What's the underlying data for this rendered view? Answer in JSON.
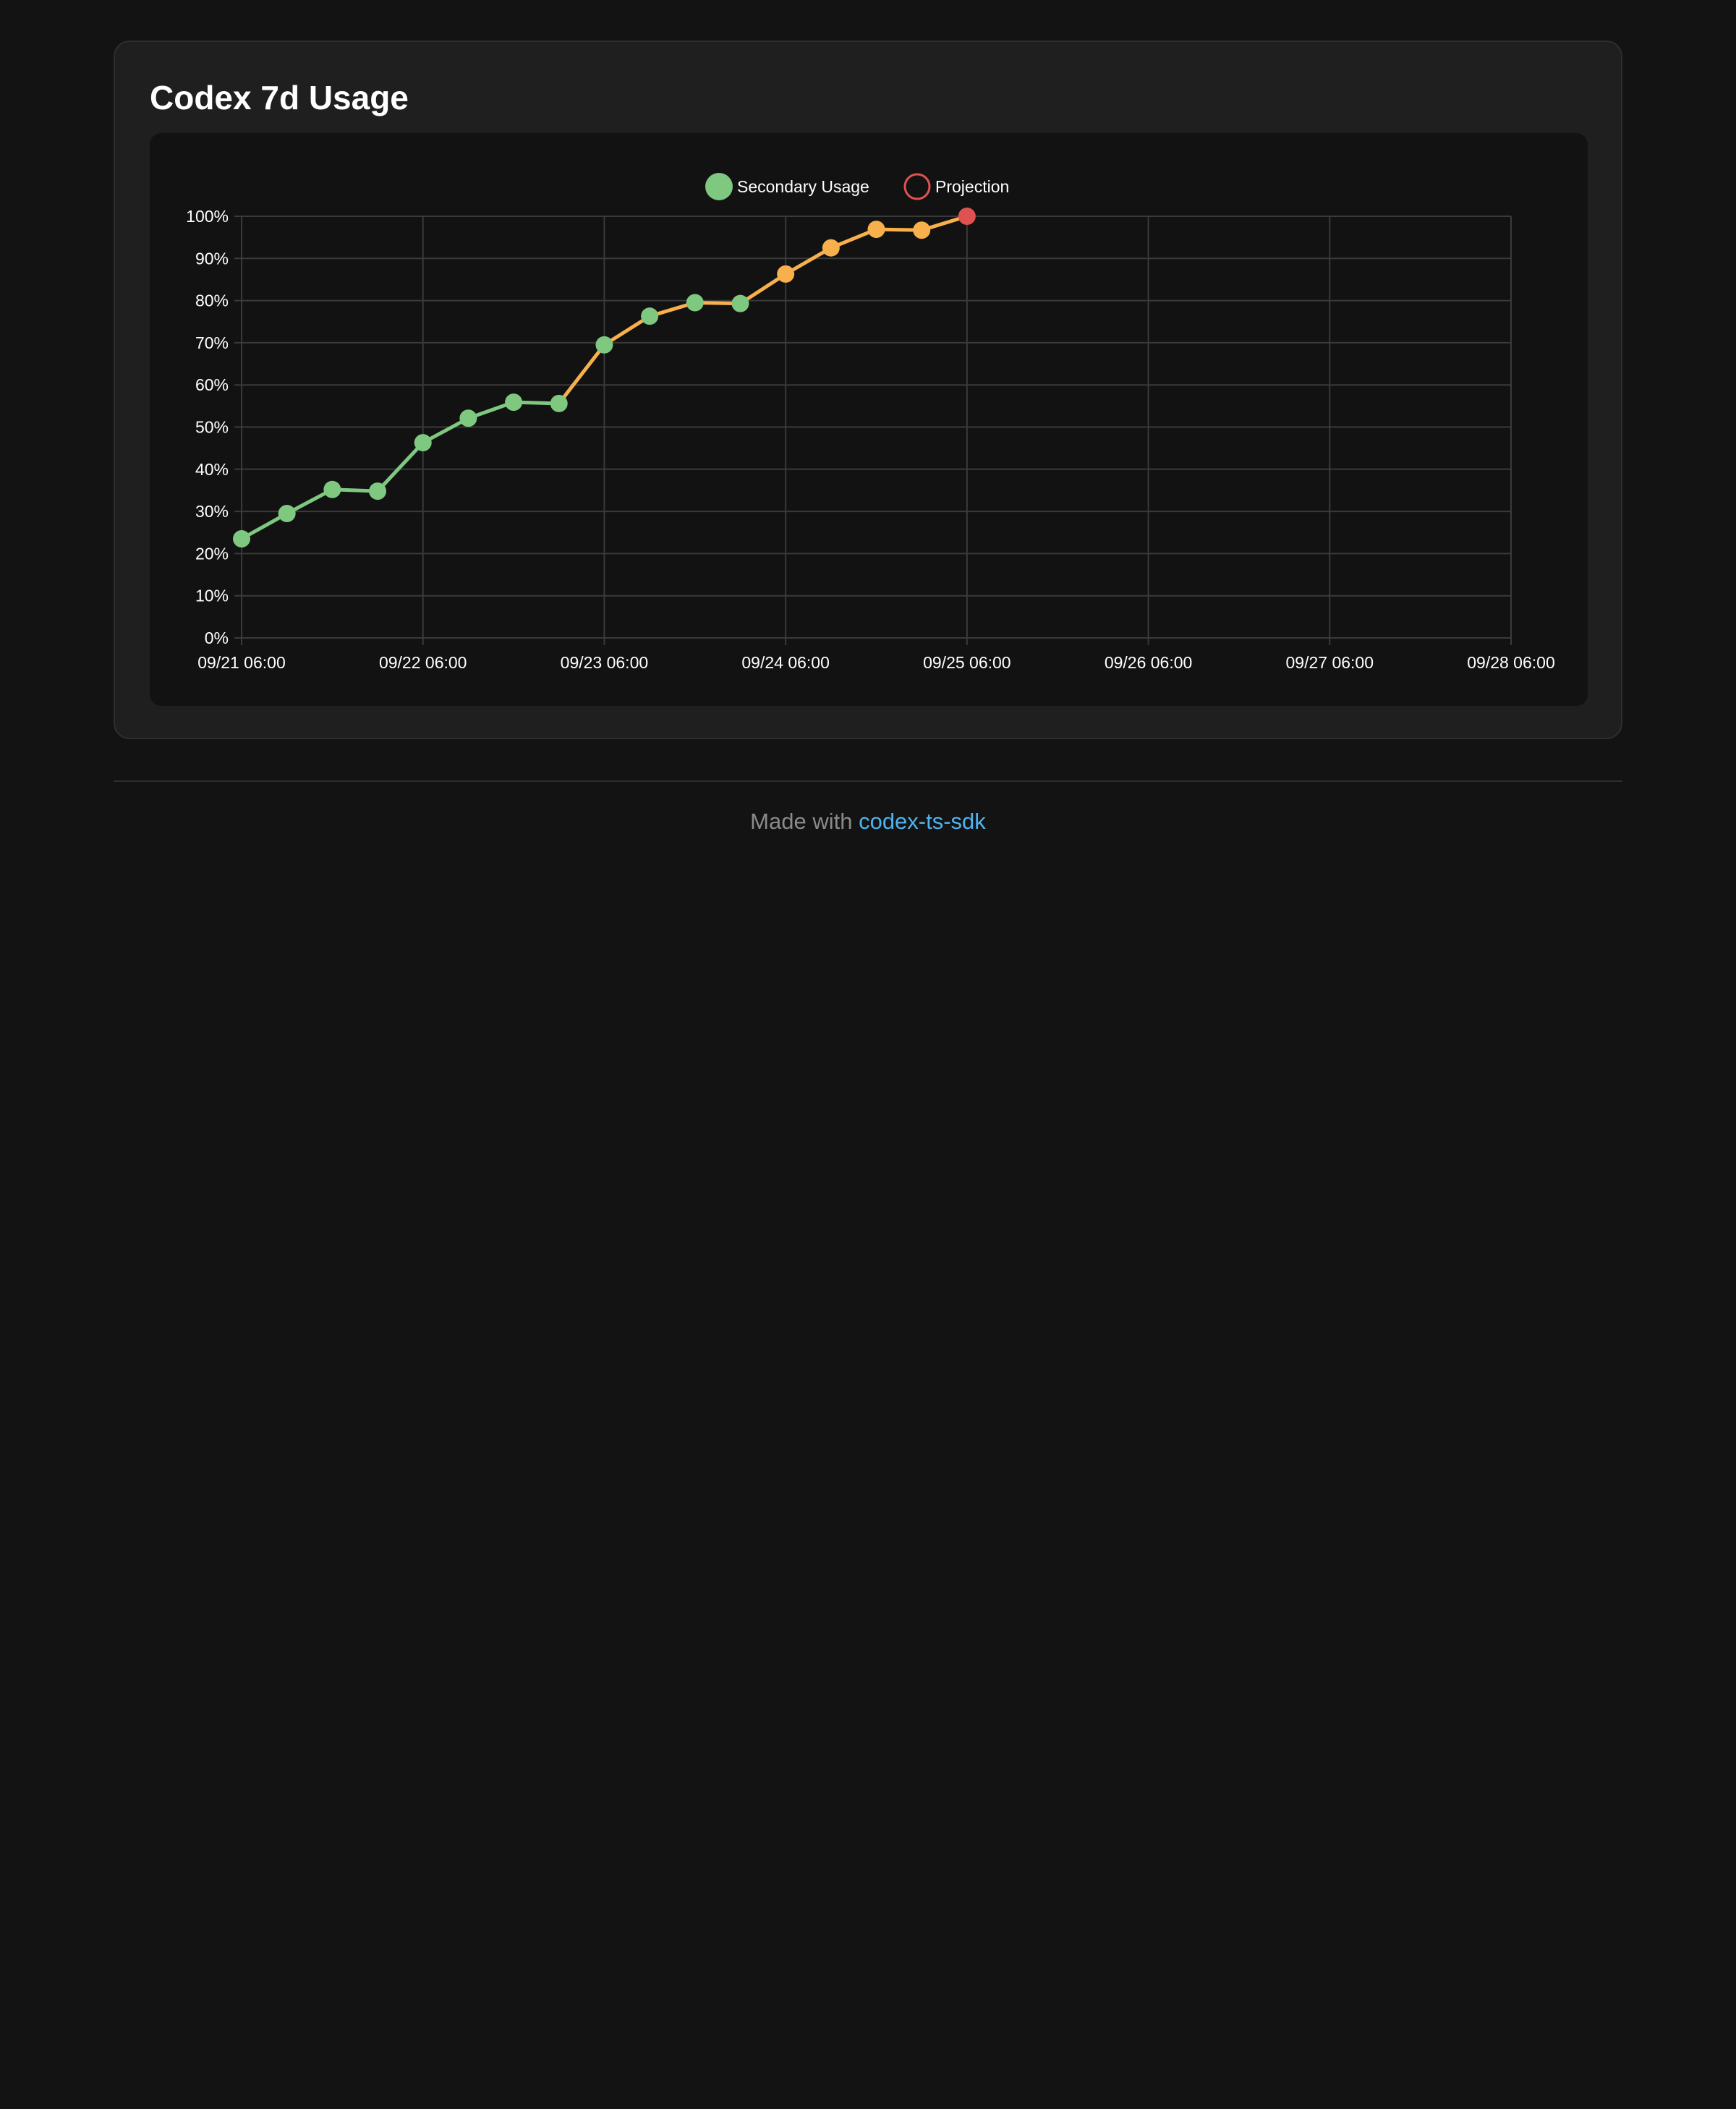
{
  "card": {
    "title": "Codex 7d Usage"
  },
  "chart_data": {
    "type": "line",
    "title": "",
    "xlabel": "",
    "ylabel": "",
    "x_range": [
      "09/21 06:00",
      "09/28 06:00"
    ],
    "x_ticks": [
      "09/21 06:00",
      "09/22 06:00",
      "09/23 06:00",
      "09/24 06:00",
      "09/25 06:00",
      "09/26 06:00",
      "09/27 06:00",
      "09/28 06:00"
    ],
    "ylim": [
      0,
      100
    ],
    "y_ticks": [
      "0%",
      "10%",
      "20%",
      "30%",
      "40%",
      "50%",
      "60%",
      "70%",
      "80%",
      "90%",
      "100%"
    ],
    "grid": true,
    "legend_position": "top-center",
    "series": [
      {
        "name": "Secondary Usage",
        "color": "#7ec87f",
        "points": [
          {
            "x": "09/21 06:00",
            "y": 23.5
          },
          {
            "x": "09/21 12:00",
            "y": 29.5
          },
          {
            "x": "09/21 18:00",
            "y": 35.2
          },
          {
            "x": "09/22 00:00",
            "y": 34.8
          },
          {
            "x": "09/22 06:00",
            "y": 46.3
          },
          {
            "x": "09/22 12:00",
            "y": 52.1
          },
          {
            "x": "09/22 18:00",
            "y": 55.9
          },
          {
            "x": "09/23 00:00",
            "y": 55.6
          },
          {
            "x": "09/23 06:00",
            "y": 69.5
          },
          {
            "x": "09/23 12:00",
            "y": 76.3
          },
          {
            "x": "09/23 18:00",
            "y": 79.5
          },
          {
            "x": "09/24 00:00",
            "y": 79.3
          },
          {
            "x": "09/24 06:00",
            "y": 86.3
          },
          {
            "x": "09/24 12:00",
            "y": 92.5
          },
          {
            "x": "09/24 18:00",
            "y": 96.9
          },
          {
            "x": "09/25 00:00",
            "y": 96.7
          },
          {
            "x": "09/25 06:00",
            "y": 100.0
          }
        ],
        "point_colors": [
          "#7ec87f",
          "#7ec87f",
          "#7ec87f",
          "#7ec87f",
          "#7ec87f",
          "#7ec87f",
          "#7ec87f",
          "#7ec87f",
          "#7ec87f",
          "#7ec87f",
          "#7ec87f",
          "#7ec87f",
          "#f7b04c",
          "#f7b04c",
          "#f7b04c",
          "#f7b04c",
          "#e05252"
        ],
        "segment_colors": [
          "#7ec87f",
          "#7ec87f",
          "#7ec87f",
          "#7ec87f",
          "#7ec87f",
          "#7ec87f",
          "#7ec87f",
          "#f7b04c",
          "#f7b04c",
          "#f7b04c",
          "#f7b04c",
          "#f7b04c",
          "#f7b04c",
          "#f7b04c",
          "#f7b04c",
          "#f7b04c"
        ]
      },
      {
        "name": "Projection",
        "color": "#e05252",
        "points": []
      }
    ]
  },
  "footer": {
    "prefix": "Made with ",
    "link_text": "codex-ts-sdk"
  },
  "colors": {
    "background": "#131313",
    "card": "#1f1f1f",
    "chart_panel": "#121212",
    "grid": "#3a3a3a",
    "link": "#4fb3ee",
    "usage_green": "#7ec87f",
    "usage_orange": "#f7b04c",
    "projection_red": "#e05252"
  }
}
